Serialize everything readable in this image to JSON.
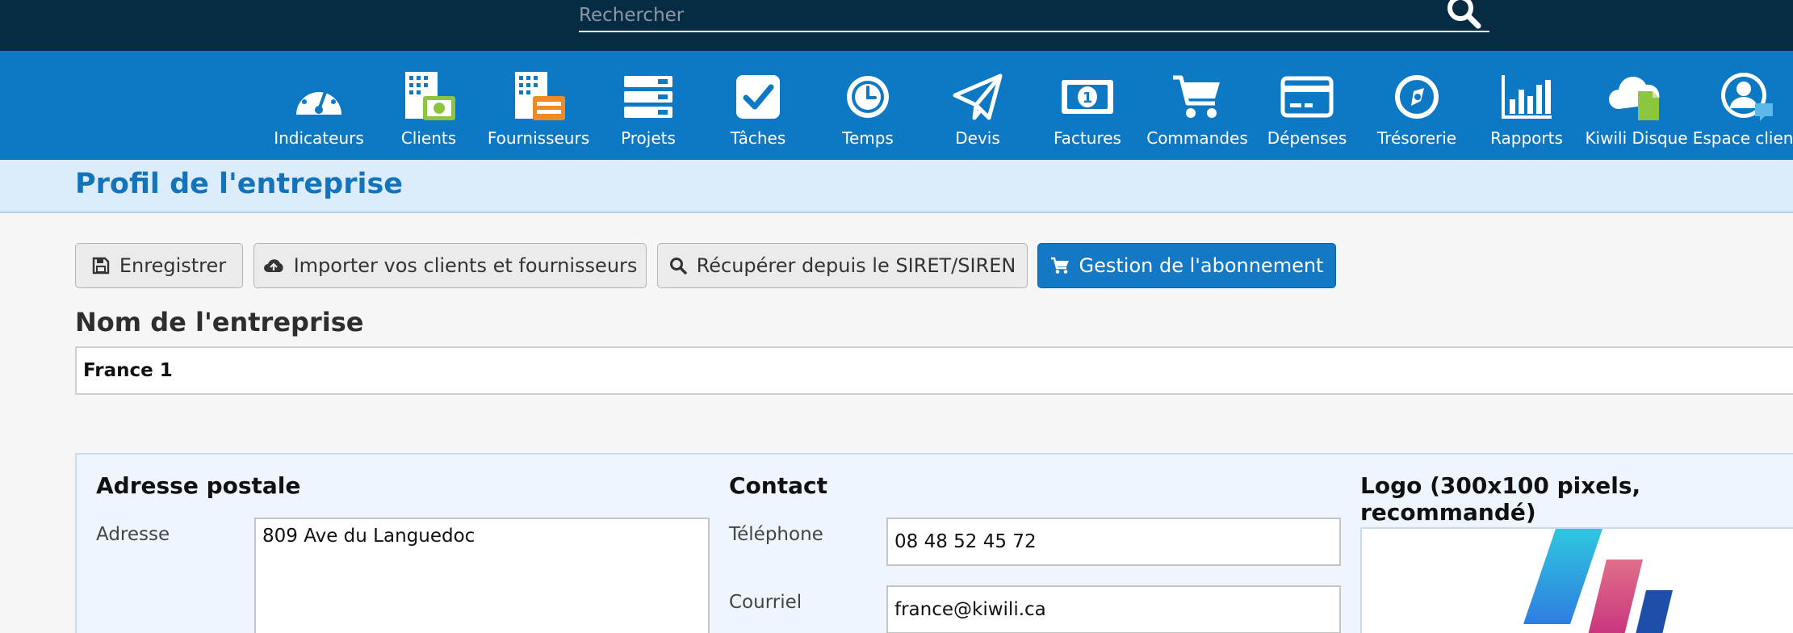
{
  "search": {
    "placeholder": "Rechercher"
  },
  "nav": [
    {
      "label": "Indicateurs",
      "icon": "dashboard-icon"
    },
    {
      "label": "Clients",
      "icon": "clients-icon"
    },
    {
      "label": "Fournisseurs",
      "icon": "suppliers-icon"
    },
    {
      "label": "Projets",
      "icon": "projects-icon"
    },
    {
      "label": "Tâches",
      "icon": "tasks-icon"
    },
    {
      "label": "Temps",
      "icon": "clock-icon"
    },
    {
      "label": "Devis",
      "icon": "paper-plane-icon"
    },
    {
      "label": "Factures",
      "icon": "invoice-icon"
    },
    {
      "label": "Commandes",
      "icon": "cart-icon"
    },
    {
      "label": "Dépenses",
      "icon": "credit-card-icon"
    },
    {
      "label": "Trésorerie",
      "icon": "compass-icon"
    },
    {
      "label": "Rapports",
      "icon": "bar-chart-icon"
    },
    {
      "label": "Kiwili Disque",
      "icon": "cloud-file-icon"
    },
    {
      "label": "Espace client",
      "icon": "user-chat-icon"
    }
  ],
  "page": {
    "title": "Profil de l'entreprise"
  },
  "toolbar": {
    "save": "Enregistrer",
    "import": "Importer vos clients et fournisseurs",
    "siret": "Récupérer depuis le SIRET/SIREN",
    "subscription": "Gestion de l'abonnement"
  },
  "company": {
    "label": "Nom de l'entreprise",
    "value": "France 1"
  },
  "address": {
    "title": "Adresse postale",
    "address_label": "Adresse",
    "address_value": "809 Ave du Languedoc"
  },
  "contact": {
    "title": "Contact",
    "phone_label": "Téléphone",
    "phone_value": "08 48 52 45 72",
    "email_label": "Courriel",
    "email_value": "france@kiwili.ca"
  },
  "logo": {
    "title": "Logo (300x100 pixels, recommandé)"
  },
  "colors": {
    "topbar": "#062b42",
    "navbar": "#0d78c3",
    "accent": "#1479c4",
    "title": "#1374bb"
  }
}
